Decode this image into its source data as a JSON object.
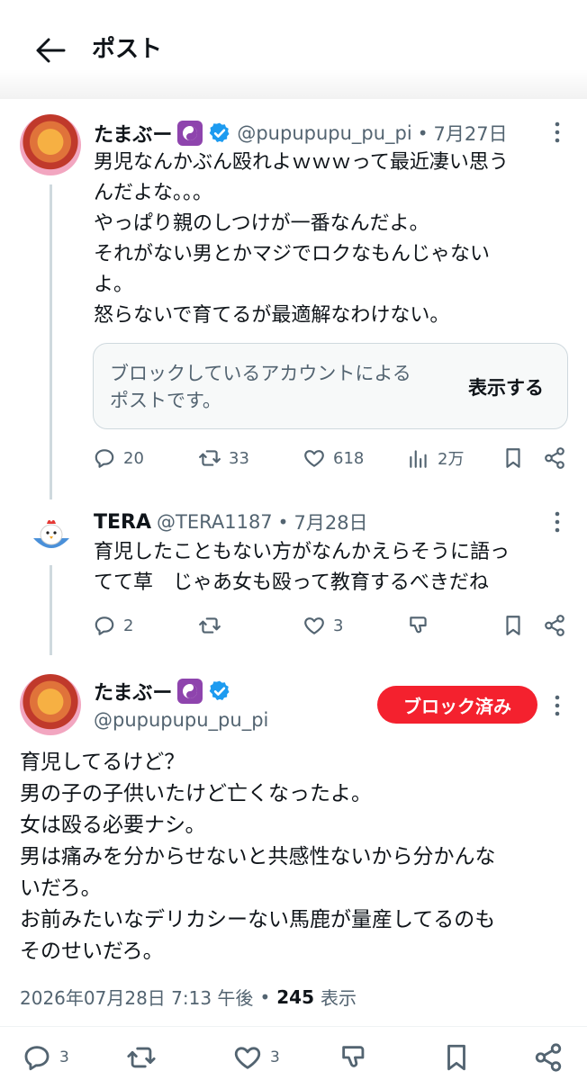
{
  "header": {
    "title": "ポスト",
    "back_icon": "arrow-left-icon"
  },
  "post1": {
    "name": "たまぶー",
    "handle": "@pupupupu_pu_pi",
    "sep": "•",
    "date": "7月27日",
    "lines": [
      "男児なんかぶん殴れよｗｗｗって最近凄い思う",
      "んだよな。。。",
      "やっぱり親のしつけが一番なんだよ。",
      "それがない男とかマジでロクなもんじゃない",
      "よ。",
      "怒らないで育てるが最適解なわけない。"
    ],
    "quote_text_1": "ブロックしているアカウントによる",
    "quote_text_2": "ポストです。",
    "quote_action": "表示する",
    "replies": "20",
    "retweets": "33",
    "likes": "618",
    "views": "2万"
  },
  "post2": {
    "name": "TERA",
    "handle": "@TERA1187",
    "sep": "•",
    "date": "7月28日",
    "lines": [
      "育児したこともない方がなんかえらそうに語っ",
      "てて草　じゃあ女も殴って教育するべきだね"
    ],
    "replies": "2",
    "likes": "3"
  },
  "main_post": {
    "name": "たまぶー",
    "handle": "@pupupupu_pu_pi",
    "blocked_label": "ブロック済み",
    "lines": [
      "育児してるけど？",
      "男の子の子供いたけど亡くなったよ。",
      "女は殴る必要ナシ。",
      "男は痛みを分からせないと共感性ないから分かんな",
      "いだろ。",
      "お前みたいなデリカシーない馬鹿が量産してるのも",
      "そのせいだろ。"
    ],
    "timestamp": "2026年07月28日 7:13 午後",
    "sep": "•",
    "views_count": "245",
    "views_label": "表示",
    "replies": "3",
    "likes": "3"
  },
  "colors": {
    "accent": "#1d9bf0",
    "blocked": "#f4212e",
    "text": "#0f1419",
    "muted": "#536471",
    "thread_line": "#cfd9de",
    "yinyang_bg": "#8e44ad"
  }
}
